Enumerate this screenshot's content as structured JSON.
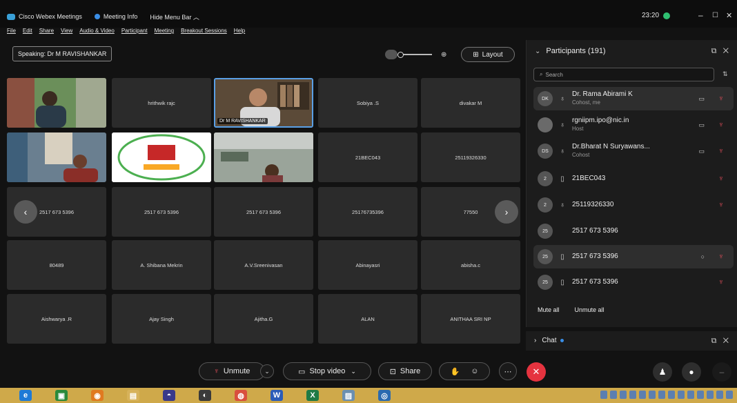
{
  "titlebar": {
    "app_name": "Cisco Webex Meetings",
    "meeting_info": "Meeting Info",
    "hide_menu": "Hide Menu Bar ︿",
    "time": "23:20",
    "minimize": "–",
    "maximize": "☐",
    "close": "✕"
  },
  "menu": [
    "File",
    "Edit",
    "Share",
    "View",
    "Audio & Video",
    "Participant",
    "Meeting",
    "Breakout Sessions",
    "Help"
  ],
  "speaking": "Speaking: Dr M RAVISHANKAR",
  "layout_label": "Layout",
  "grid": {
    "row1": [
      "",
      "hrithwik rajc",
      "Dr M RAVISHANKAR",
      "Sobiya .S",
      "divakar M"
    ],
    "row2": [
      "",
      "",
      "",
      "21BEC043",
      "25119326330"
    ],
    "row3": [
      "2517 673 5396",
      "2517 673 5396",
      "2517 673 5396",
      "25176735396",
      "77550"
    ],
    "row4": [
      "80489",
      "A. Shibana Mekrin",
      "A.V.Sreenivasan",
      "Abinayasri",
      "abisha.c"
    ],
    "row5": [
      "Aishwarya .R",
      "Ajay Singh",
      "Ajitha.G",
      "ALAN",
      "ANITHAA SRI NP"
    ]
  },
  "participants": {
    "header": "Participants (191)",
    "search_placeholder": "Search",
    "list": [
      {
        "initials": "DK",
        "name": "Dr. Rama Abirami K",
        "role": "Cohost, me"
      },
      {
        "initials": "",
        "name": "rgniipm.ipo@nic.in",
        "role": "Host"
      },
      {
        "initials": "DS",
        "name": "Dr.Bharat N Suryawans...",
        "role": "Cohost"
      },
      {
        "initials": "2",
        "name": "21BEC043",
        "role": ""
      },
      {
        "initials": "2",
        "name": "25119326330",
        "role": ""
      },
      {
        "initials": "25",
        "name": "2517 673 5396",
        "role": ""
      },
      {
        "initials": "25",
        "name": "2517 673 5396",
        "role": ""
      },
      {
        "initials": "25",
        "name": "2517 673 5396",
        "role": ""
      }
    ],
    "mute_all": "Mute all",
    "unmute_all": "Unmute all"
  },
  "chat": {
    "label": "Chat"
  },
  "toolbar": {
    "unmute": "Unmute",
    "stop_video": "Stop video",
    "share": "Share"
  },
  "colors": {
    "accent": "#3a8ee6",
    "end_call": "#e5333f",
    "muted": "#e04e5a",
    "taskbar": "#cfa94a"
  }
}
